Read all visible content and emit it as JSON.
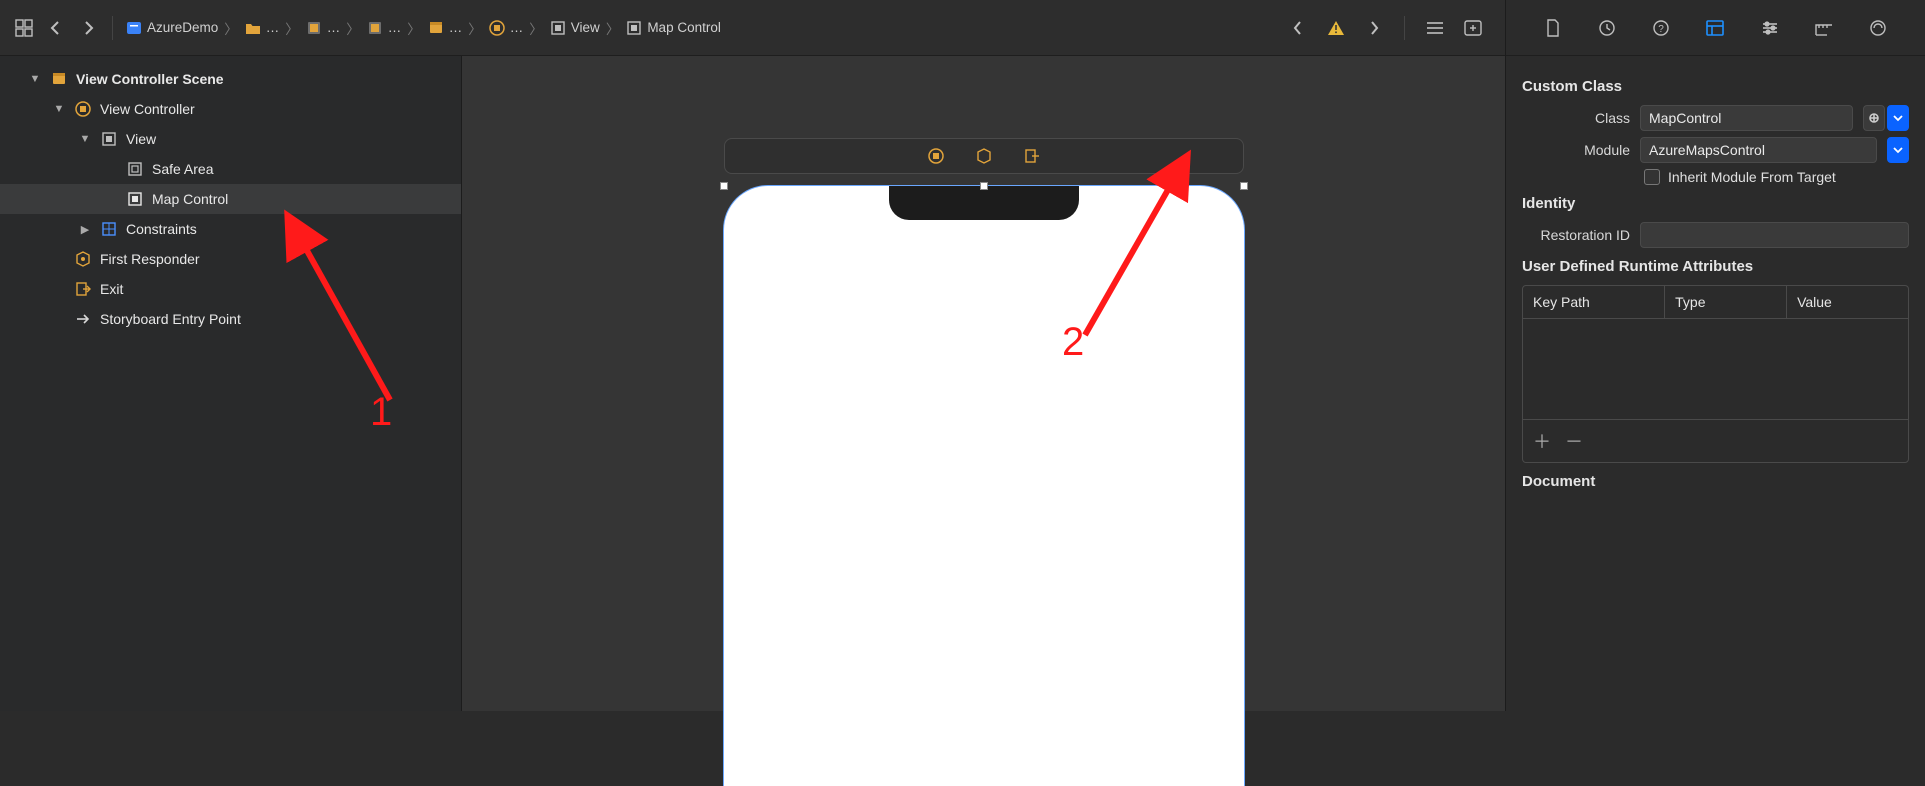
{
  "breadcrumb": {
    "project": "AzureDemo",
    "ellipsis": "…",
    "view": "View",
    "mapcontrol": "Map Control"
  },
  "outline": {
    "scene": "View Controller Scene",
    "vc": "View Controller",
    "view": "View",
    "safeArea": "Safe Area",
    "mapControl": "Map Control",
    "constraints": "Constraints",
    "firstResponder": "First Responder",
    "exit": "Exit",
    "entry": "Storyboard Entry Point"
  },
  "inspector": {
    "customClass": {
      "title": "Custom Class",
      "classLabel": "Class",
      "classValue": "MapControl",
      "moduleLabel": "Module",
      "moduleValue": "AzureMapsControl",
      "inheritLabel": "Inherit Module From Target"
    },
    "identity": {
      "title": "Identity",
      "restorationLabel": "Restoration ID",
      "restorationValue": ""
    },
    "runtime": {
      "title": "User Defined Runtime Attributes",
      "keypath": "Key Path",
      "type": "Type",
      "value": "Value"
    },
    "document": {
      "title": "Document"
    }
  },
  "annotations": {
    "one": "1",
    "two": "2"
  }
}
